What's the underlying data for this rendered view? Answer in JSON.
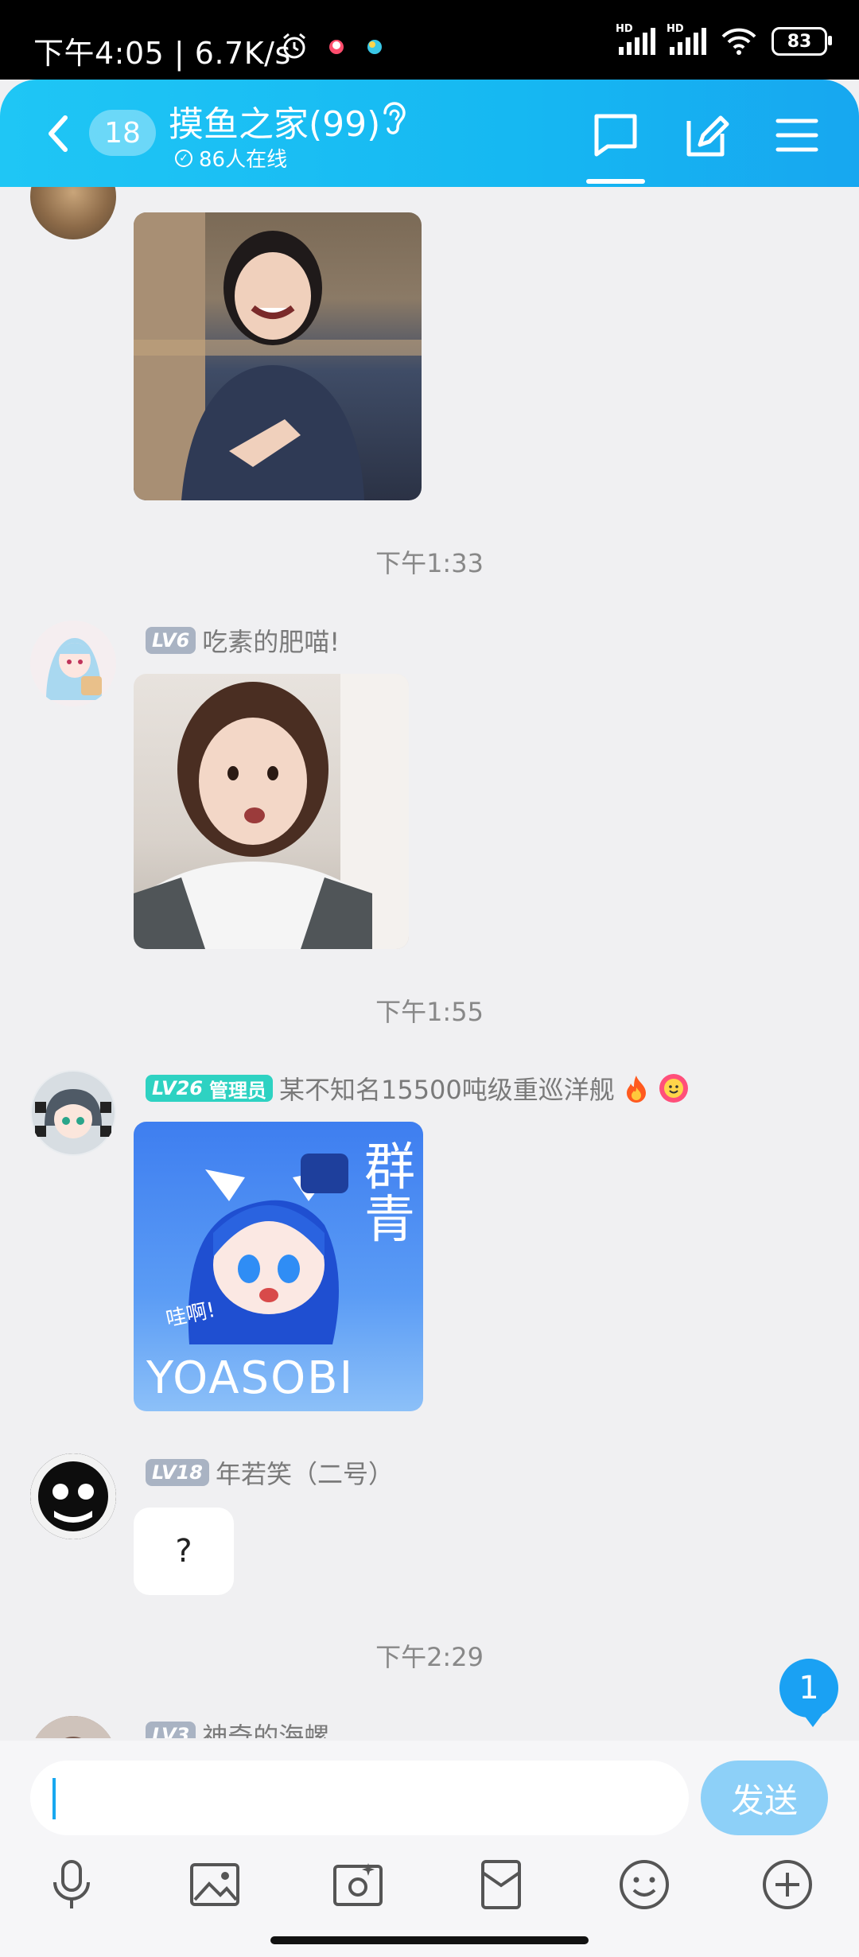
{
  "status_bar": {
    "time": "下午4:05 | 6.7K/s",
    "battery": "83",
    "network_label": "HD"
  },
  "header": {
    "unread_count": "18",
    "title": "摸鱼之家(99)",
    "online_status": "86人在线"
  },
  "messages": [
    {
      "type": "timestamp",
      "text": "下午1:33"
    },
    {
      "type": "sender",
      "level": "LV6",
      "name": "吃素的肥喵!"
    },
    {
      "type": "timestamp",
      "text": "下午1:55"
    },
    {
      "type": "sender",
      "level": "LV26",
      "role": "管理员",
      "name": "某不知名15500吨级重巡洋舰"
    },
    {
      "type": "sticker_text",
      "title": "群青",
      "artist": "YOASOBI",
      "shout": "哇啊!"
    },
    {
      "type": "sender",
      "level": "LV18",
      "name": "年若笑（二号）"
    },
    {
      "type": "text",
      "text": "?"
    },
    {
      "type": "timestamp",
      "text": "下午2:29"
    },
    {
      "type": "sender",
      "level": "LV3",
      "name": "神奇的海螺"
    }
  ],
  "new_message_badge": "1",
  "composer": {
    "placeholder": "",
    "send_label": "发送"
  },
  "toolbar": [
    "microphone-icon",
    "image-icon",
    "camera-icon",
    "red-packet-icon",
    "emoji-icon",
    "plus-icon"
  ],
  "colors": {
    "header_start": "#1fc6f5",
    "header_end": "#17a7f0",
    "accent": "#1aa1f3",
    "admin_badge": "#2ed2c2",
    "level_badge": "#a9b3c3"
  }
}
